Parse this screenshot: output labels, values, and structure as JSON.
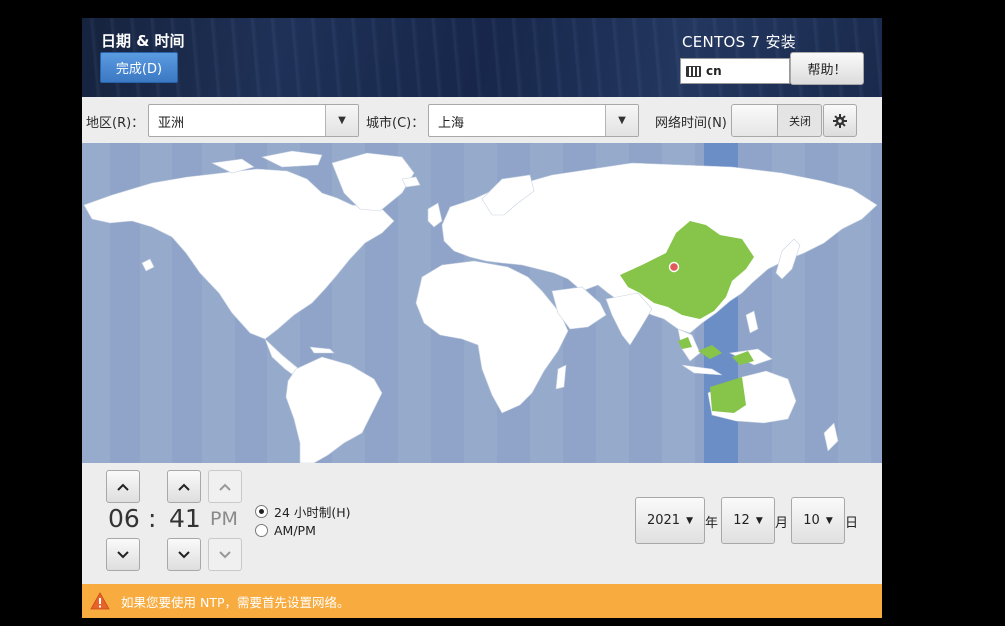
{
  "header": {
    "title": "日期 & 时间",
    "done_label": "完成(D)",
    "product": "CENTOS 7 安装",
    "keyboard_layout": "cn",
    "help_label": "帮助！"
  },
  "selectors": {
    "region_label": "地区(R)：",
    "region_value": "亚洲",
    "city_label": "城市(C)：",
    "city_value": "上海",
    "ntp_label": "网络时间(N)",
    "ntp_state": "关闭"
  },
  "time": {
    "hour": "06",
    "separator": ":",
    "minute": "41",
    "ampm": "PM",
    "format_24h": "24 小时制(H)",
    "format_ampm": "AM/PM",
    "selected_format": "24h"
  },
  "date": {
    "year": "2021",
    "year_unit": "年",
    "month": "12",
    "month_unit": "月",
    "day": "10",
    "day_unit": "日"
  },
  "warning": {
    "text": "如果您要使用 NTP，需要首先设置网络。"
  },
  "colors": {
    "ocean": "#8fa4c8",
    "selected_zone": "#6b8ec6",
    "selected_country": "#86c54a",
    "warning_bar": "#f8ab3e",
    "done_button": "#3b79c4"
  },
  "icons": {
    "keyboard": "keyboard-icon",
    "dropdown": "chevron-down-icon",
    "settings": "gear-icon",
    "increment": "chevron-up-icon",
    "decrement": "chevron-down-icon",
    "warning": "warning-triangle-icon",
    "pin": "location-pin-icon"
  }
}
